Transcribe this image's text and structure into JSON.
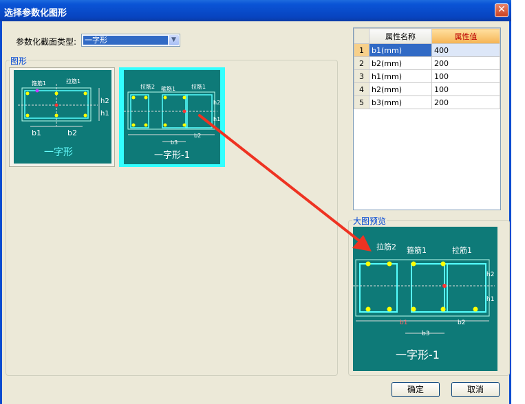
{
  "window": {
    "title": "选择参数化图形",
    "close_glyph": "✕"
  },
  "section_type": {
    "label": "参数化截面类型:",
    "value": "一字形"
  },
  "group_shapes": {
    "label": "图形"
  },
  "shapes": [
    {
      "caption": "一字形",
      "labels": {
        "stirrup": "箍筋1",
        "tie": "拉筋1",
        "b1": "b1",
        "b2": "b2",
        "h1": "h1",
        "h2": "h2"
      }
    },
    {
      "caption": "一字形-1",
      "labels": {
        "tie2": "拉筋2",
        "stirrup": "箍筋1",
        "tie": "拉筋1",
        "b3": "b3",
        "b2": "b2",
        "h1": "h1",
        "h2": "h2"
      }
    }
  ],
  "properties": {
    "headers": [
      "属性名称",
      "属性值"
    ],
    "rows": [
      {
        "num": "1",
        "name": "b1(mm)",
        "value": "400"
      },
      {
        "num": "2",
        "name": "b2(mm)",
        "value": "200"
      },
      {
        "num": "3",
        "name": "h1(mm)",
        "value": "100"
      },
      {
        "num": "4",
        "name": "h2(mm)",
        "value": "100"
      },
      {
        "num": "5",
        "name": "b3(mm)",
        "value": "200"
      }
    ]
  },
  "preview": {
    "label": "大图预览",
    "caption": "一字形-1",
    "labels": {
      "tie2": "拉筋2",
      "stirrup": "箍筋1",
      "tie": "拉筋1",
      "b1": "b1",
      "b2": "b2",
      "b3": "b3",
      "h1": "h1",
      "h2": "h2"
    }
  },
  "buttons": {
    "ok": "确定",
    "cancel": "取消"
  },
  "colors": {
    "titlebar": "#0a54d6",
    "thumb_bg": "#0e7a78",
    "selection": "#316ac5",
    "annotation_arrow": "#ee3322"
  }
}
